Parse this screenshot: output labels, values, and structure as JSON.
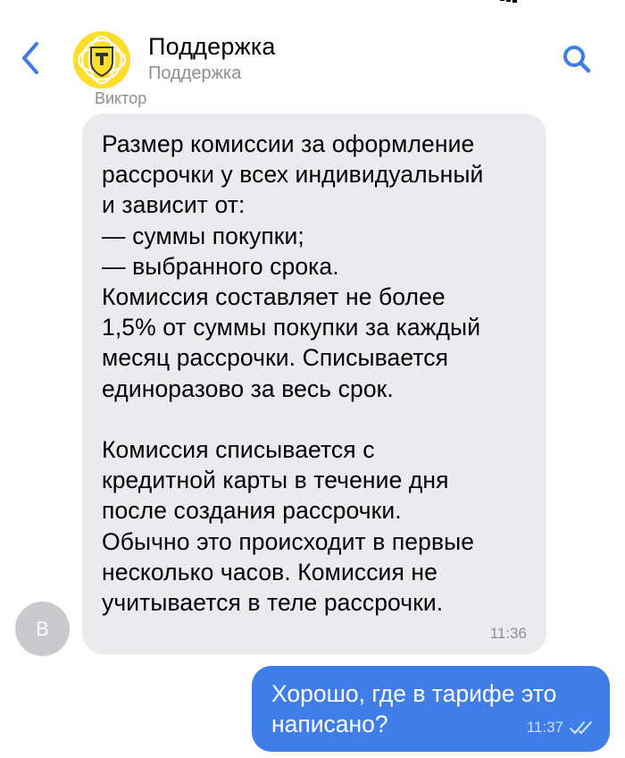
{
  "header": {
    "title": "Поддержка",
    "subtitle": "Поддержка"
  },
  "colors": {
    "accent": "#3f7de9",
    "incoming_bubble": "#ebebed",
    "logo_bg": "#ffdd2d",
    "muted_text": "#8e8e93"
  },
  "icons": {
    "back": "chevron-left-icon",
    "search": "search-icon",
    "logo": "tinkoff-shield-logo",
    "read": "double-check-icon"
  },
  "messages": {
    "incoming": {
      "sender_name": "Виктор",
      "avatar_initial": "В",
      "text": "Размер комиссии за оформление\nрассрочки у всех индивидуальный\nи зависит от:\n— суммы покупки;\n— выбранного срока.\nКомиссия составляет не более\n1,5% от суммы покупки за каждый\nмесяц рассрочки. Списывается\nединоразово за весь срок.\n\nКомиссия списывается с\nкредитной карты в течение дня\nпосле создания рассрочки.\nОбычно это происходит в первые\nнесколько часов. Комиссия не\nучитывается в теле рассрочки.",
      "time": "11:36"
    },
    "outgoing": {
      "text": "Хорошо, где в тарифе это\nнаписано?",
      "time": "11:37",
      "status": "read"
    }
  }
}
